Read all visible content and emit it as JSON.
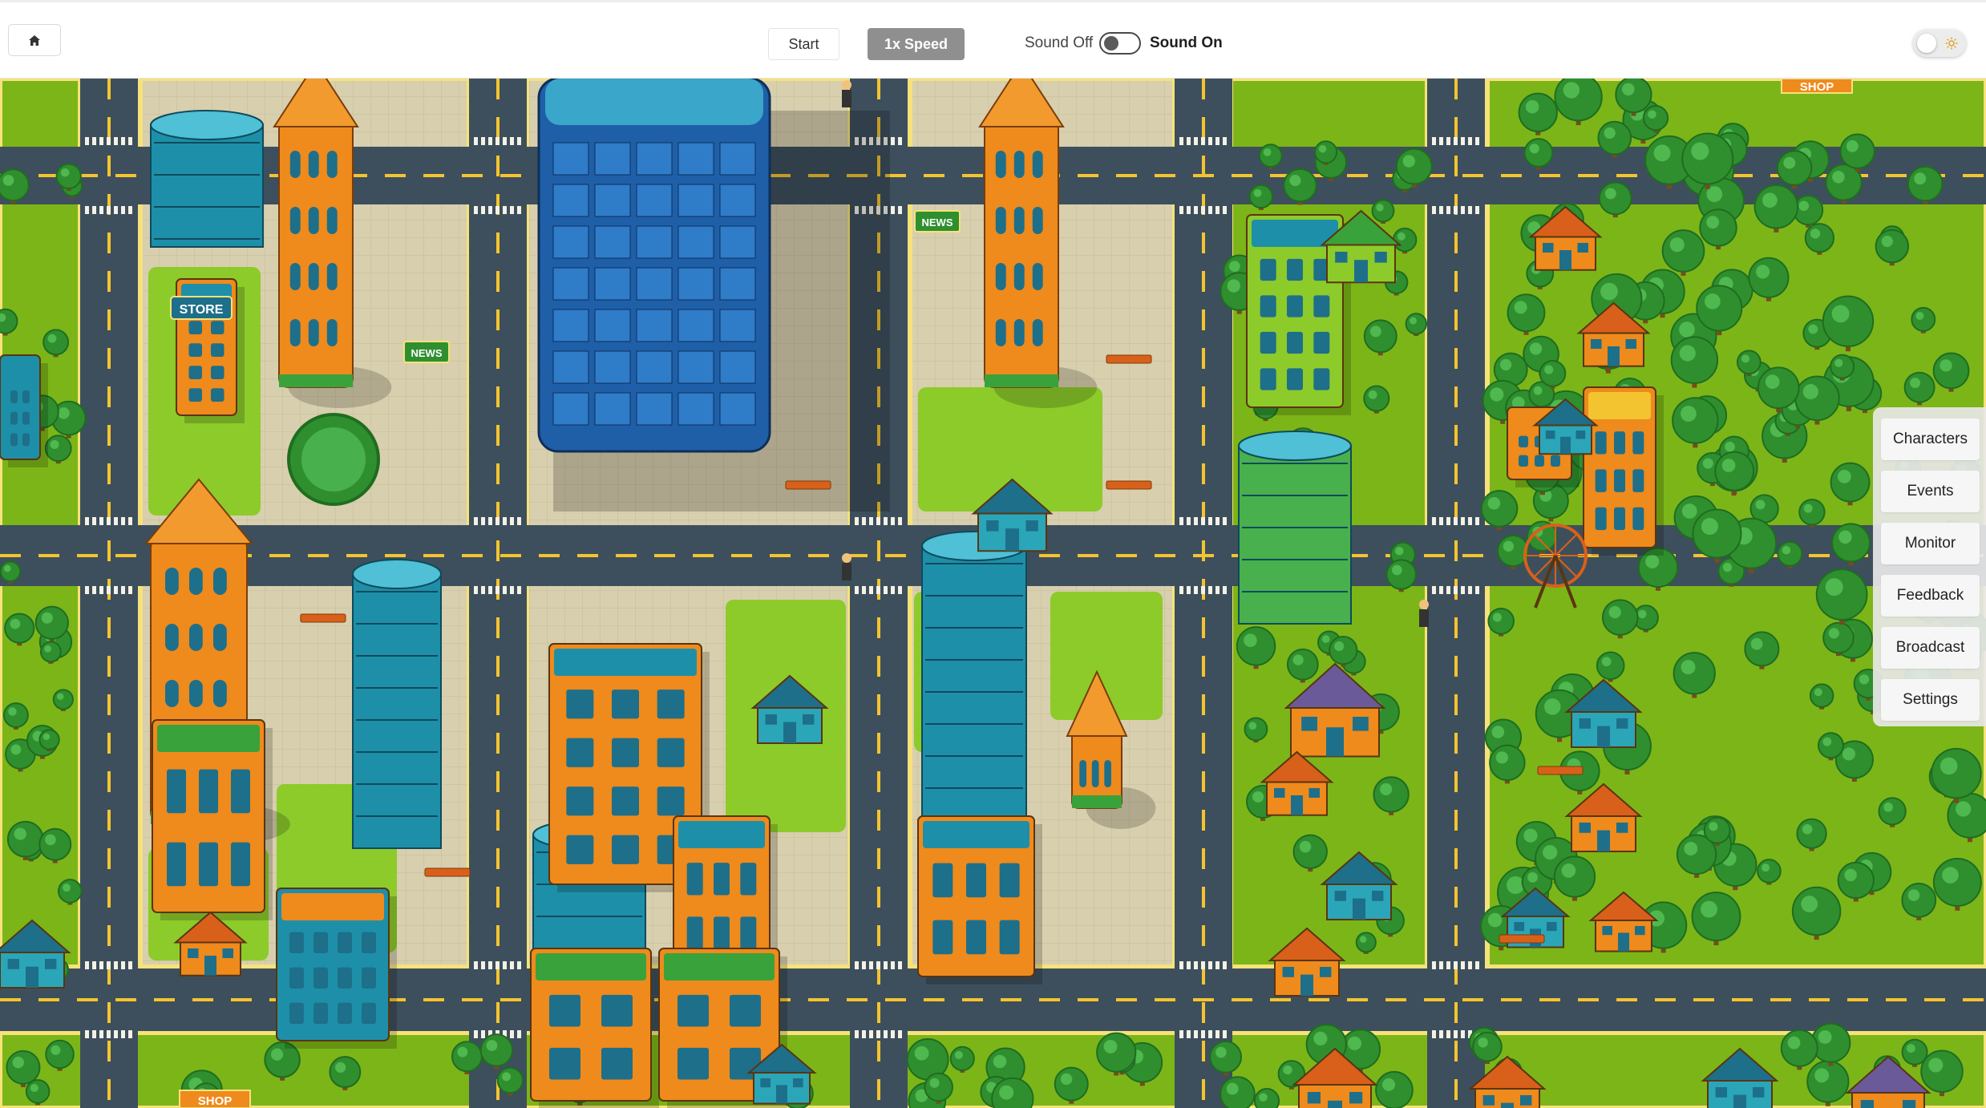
{
  "toolbar": {
    "home_icon": "home-icon",
    "start_label": "Start",
    "speed_label": "1x Speed",
    "sound_off_label": "Sound Off",
    "sound_on_label": "Sound On",
    "theme_icon": "sun-icon"
  },
  "side_menu": {
    "items": [
      "Characters",
      "Events",
      "Monitor",
      "Feedback",
      "Broadcast",
      "Settings"
    ]
  },
  "map": {
    "signs": {
      "store": "STORE",
      "news_1": "NEWS",
      "news_2": "NEWS",
      "shop_1": "SHOP",
      "shop_2": "SHOP"
    }
  },
  "colors": {
    "grass": "#7cb518",
    "road": "#3d4f5c",
    "lane_marking": "#f4c430",
    "sidewalk": "#d8cfae",
    "curb": "#f6e27a",
    "orange_building": "#ef8a1c",
    "teal_building": "#1e8fa8",
    "blue_tower": "#1f5fa8",
    "tree": "#2f8f2f",
    "speed_button": "#8f8f8f"
  }
}
